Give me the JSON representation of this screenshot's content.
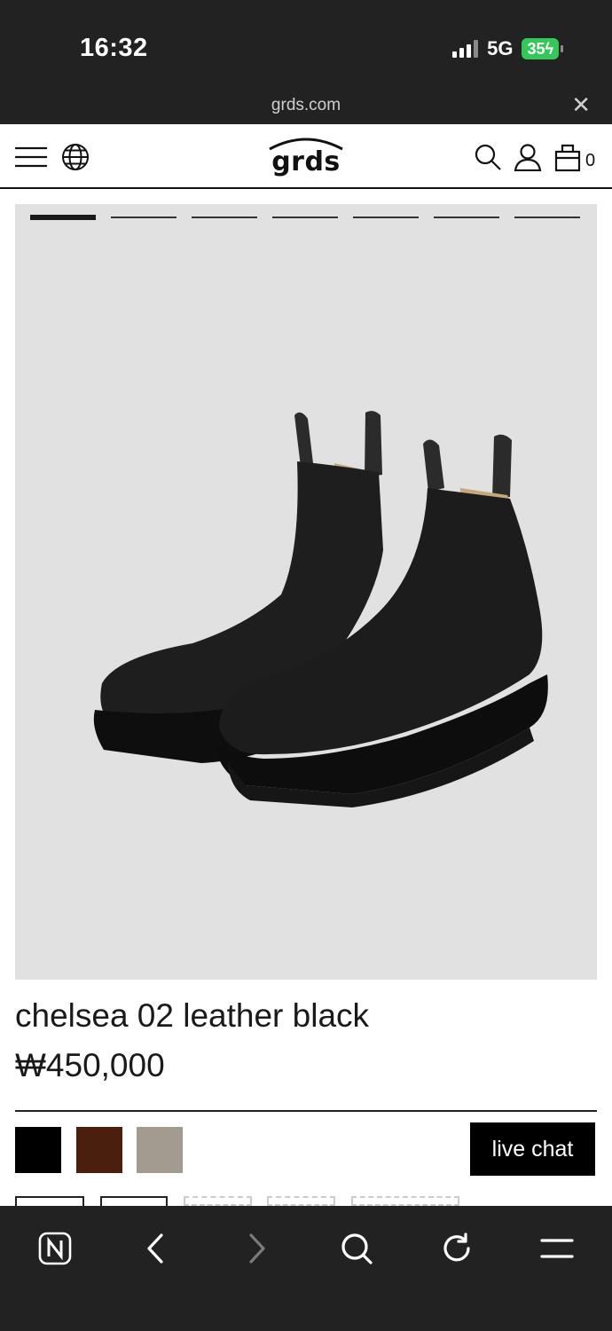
{
  "status_bar": {
    "time": "16:32",
    "network": "5G",
    "battery": "35"
  },
  "browser": {
    "url": "grds.com",
    "close_icon": "close-icon"
  },
  "header": {
    "logo_text": "grds",
    "cart_count": "0",
    "icons": [
      "menu-icon",
      "globe-icon",
      "search-icon",
      "user-icon",
      "cart-icon"
    ]
  },
  "gallery": {
    "slide_count": 7,
    "active_slide": 1
  },
  "product": {
    "name": "chelsea 02 leather black",
    "price": "₩450,000",
    "colors": [
      "#000000",
      "#4a1f0e",
      "#a39b90"
    ]
  },
  "chat": {
    "label": "live chat"
  },
  "toolbar": {
    "icons": [
      "naver-icon",
      "back-icon",
      "forward-icon",
      "search-icon",
      "refresh-icon",
      "menu-icon"
    ]
  }
}
